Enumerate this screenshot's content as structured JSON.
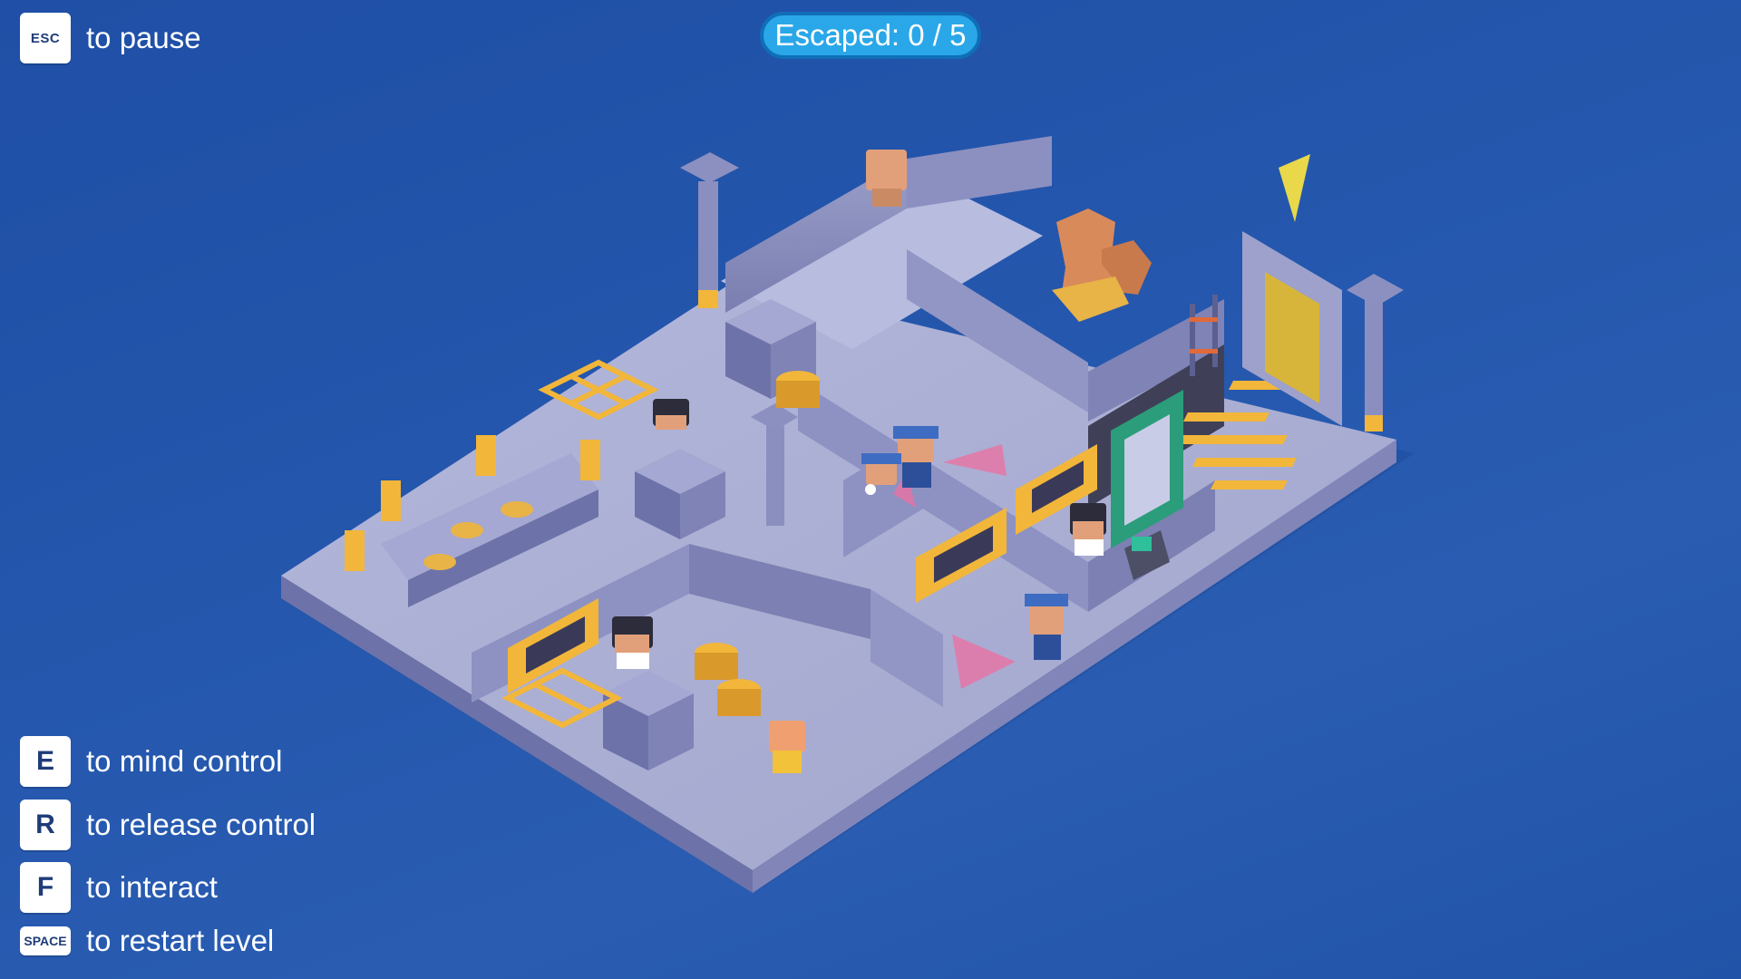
{
  "hud": {
    "counter": "Escaped: 0 / 5",
    "controls": [
      {
        "key": "ESC",
        "action": "to pause"
      },
      {
        "key": "E",
        "action": "to mind control"
      },
      {
        "key": "R",
        "action": "to release control"
      },
      {
        "key": "F",
        "action": "to interact"
      },
      {
        "key": "SPACE",
        "action": "to restart level"
      }
    ]
  },
  "colors": {
    "background": "#2152a6",
    "floor": "#a7abd0",
    "wall": "#8b8fbf",
    "accent_gold": "#f2b63a",
    "exit_marker": "#e8d84a",
    "guard_cone": "#ee6fa0",
    "counter_fill": "#2aa7e8"
  },
  "scene": {
    "description_icons": [
      "exit-marker-icon",
      "guard",
      "scientist",
      "prisoner"
    ]
  }
}
